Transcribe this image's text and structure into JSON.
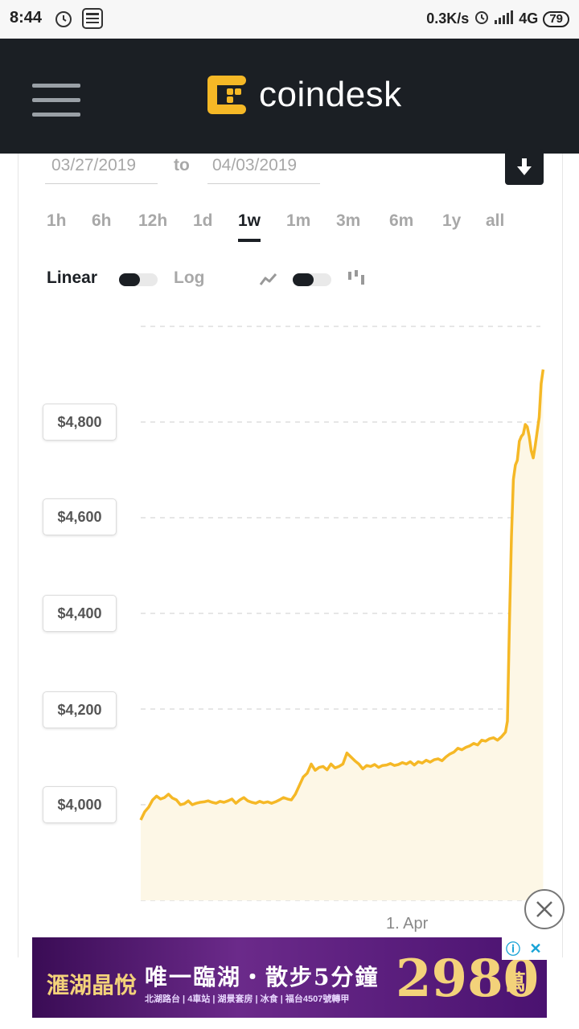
{
  "status_bar": {
    "time": "8:44",
    "network_speed": "0.3K/s",
    "network_type": "4G",
    "battery": "79"
  },
  "header": {
    "logo_text": "coindesk",
    "menu_icon": "hamburger-icon",
    "accent_color": "#f5b826",
    "bg_color": "#1b1f24"
  },
  "date_range": {
    "start": "03/27/2019",
    "separator": "to",
    "end": "04/03/2019",
    "download_icon": "download-arrow-icon"
  },
  "time_tabs": [
    {
      "label": "1h",
      "active": false
    },
    {
      "label": "6h",
      "active": false
    },
    {
      "label": "12h",
      "active": false
    },
    {
      "label": "1d",
      "active": false
    },
    {
      "label": "1w",
      "active": true
    },
    {
      "label": "1m",
      "active": false
    },
    {
      "label": "3m",
      "active": false
    },
    {
      "label": "6m",
      "active": false
    },
    {
      "label": "1y",
      "active": false
    },
    {
      "label": "all",
      "active": false
    }
  ],
  "scale_toggle": {
    "left_label": "Linear",
    "right_label": "Log",
    "line_icon": "line-chart-icon",
    "candle_icon": "candlestick-icon"
  },
  "chart_data": {
    "type": "area",
    "ylabel_ticks": [
      "$4,000",
      "$4,200",
      "$4,400",
      "$4,600",
      "$4,800"
    ],
    "yticks_values": [
      4000,
      4200,
      4400,
      4600,
      4800
    ],
    "ylim": [
      3800,
      5000
    ],
    "xtick_labels": [
      "1. Apr"
    ],
    "grid": true,
    "line_color": "#f5b826",
    "watermark": "coindesk",
    "points": [
      [
        0.0,
        3968
      ],
      [
        0.01,
        3985
      ],
      [
        0.02,
        3995
      ],
      [
        0.03,
        4010
      ],
      [
        0.04,
        4018
      ],
      [
        0.05,
        4012
      ],
      [
        0.06,
        4015
      ],
      [
        0.07,
        4022
      ],
      [
        0.08,
        4014
      ],
      [
        0.09,
        4010
      ],
      [
        0.1,
        4000
      ],
      [
        0.11,
        4002
      ],
      [
        0.12,
        4008
      ],
      [
        0.13,
        4000
      ],
      [
        0.14,
        4003
      ],
      [
        0.15,
        4005
      ],
      [
        0.16,
        4006
      ],
      [
        0.17,
        4008
      ],
      [
        0.18,
        4005
      ],
      [
        0.19,
        4003
      ],
      [
        0.2,
        4007
      ],
      [
        0.21,
        4005
      ],
      [
        0.22,
        4008
      ],
      [
        0.23,
        4012
      ],
      [
        0.24,
        4003
      ],
      [
        0.25,
        4010
      ],
      [
        0.26,
        4015
      ],
      [
        0.27,
        4008
      ],
      [
        0.28,
        4005
      ],
      [
        0.29,
        4003
      ],
      [
        0.3,
        4007
      ],
      [
        0.31,
        4004
      ],
      [
        0.32,
        4006
      ],
      [
        0.33,
        4003
      ],
      [
        0.34,
        4006
      ],
      [
        0.35,
        4010
      ],
      [
        0.36,
        4015
      ],
      [
        0.37,
        4012
      ],
      [
        0.38,
        4010
      ],
      [
        0.39,
        4022
      ],
      [
        0.4,
        4040
      ],
      [
        0.41,
        4058
      ],
      [
        0.42,
        4066
      ],
      [
        0.43,
        4085
      ],
      [
        0.44,
        4072
      ],
      [
        0.45,
        4078
      ],
      [
        0.46,
        4080
      ],
      [
        0.47,
        4073
      ],
      [
        0.48,
        4085
      ],
      [
        0.49,
        4077
      ],
      [
        0.5,
        4080
      ],
      [
        0.51,
        4085
      ],
      [
        0.52,
        4108
      ],
      [
        0.53,
        4100
      ],
      [
        0.54,
        4092
      ],
      [
        0.55,
        4085
      ],
      [
        0.56,
        4075
      ],
      [
        0.57,
        4082
      ],
      [
        0.58,
        4080
      ],
      [
        0.59,
        4084
      ],
      [
        0.6,
        4078
      ],
      [
        0.61,
        4082
      ],
      [
        0.62,
        4083
      ],
      [
        0.63,
        4086
      ],
      [
        0.64,
        4082
      ],
      [
        0.65,
        4084
      ],
      [
        0.66,
        4088
      ],
      [
        0.67,
        4085
      ],
      [
        0.68,
        4090
      ],
      [
        0.69,
        4083
      ],
      [
        0.7,
        4090
      ],
      [
        0.71,
        4087
      ],
      [
        0.72,
        4093
      ],
      [
        0.73,
        4089
      ],
      [
        0.74,
        4094
      ],
      [
        0.75,
        4096
      ],
      [
        0.76,
        4092
      ],
      [
        0.77,
        4100
      ],
      [
        0.78,
        4106
      ],
      [
        0.79,
        4110
      ],
      [
        0.8,
        4118
      ],
      [
        0.81,
        4115
      ],
      [
        0.82,
        4120
      ],
      [
        0.83,
        4123
      ],
      [
        0.84,
        4128
      ],
      [
        0.85,
        4125
      ],
      [
        0.86,
        4135
      ],
      [
        0.87,
        4133
      ],
      [
        0.88,
        4138
      ],
      [
        0.89,
        4140
      ],
      [
        0.9,
        4135
      ],
      [
        0.91,
        4142
      ],
      [
        0.92,
        4152
      ],
      [
        0.925,
        4175
      ],
      [
        0.93,
        4380
      ],
      [
        0.935,
        4560
      ],
      [
        0.94,
        4680
      ],
      [
        0.945,
        4710
      ],
      [
        0.95,
        4720
      ],
      [
        0.955,
        4760
      ],
      [
        0.96,
        4770
      ],
      [
        0.965,
        4775
      ],
      [
        0.97,
        4795
      ],
      [
        0.975,
        4790
      ],
      [
        0.98,
        4770
      ],
      [
        0.985,
        4740
      ],
      [
        0.99,
        4725
      ],
      [
        0.995,
        4750
      ],
      [
        1.0,
        4780
      ],
      [
        1.005,
        4810
      ],
      [
        1.01,
        4880
      ],
      [
        1.015,
        4910
      ]
    ]
  },
  "ad": {
    "brand": "滙湖晶悅",
    "headline": "唯一臨湖・散步5分鐘",
    "subline": "北湖路台 | 4車站 | 湖景套房 | 冰食 | 福台4507號轉甲",
    "price": "2980",
    "unit": "萬",
    "info_icon": "info-icon",
    "close_icon": "close-icon"
  }
}
